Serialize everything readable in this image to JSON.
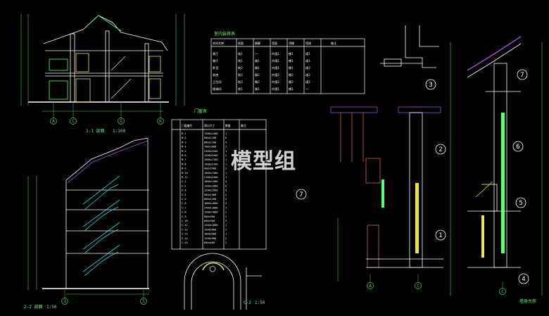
{
  "watermark": "模型组",
  "colors": {
    "background": "#000000",
    "line": "#ffffff",
    "dim": "#4fd06a",
    "text_green": "#5bff7a",
    "teal": "#2fd5d5",
    "yellow": "#e6e64a",
    "roof": "#9a4fd0",
    "wood": "#c07050"
  },
  "views": {
    "section_1": {
      "title": "1-1 剖面",
      "scale": "1:100"
    },
    "section_2": {
      "title": "2-2 剖面",
      "scale": "1:50"
    },
    "section_c": {
      "title": "C-2",
      "scale": "1:50"
    },
    "door_window_table": {
      "title": "门窗表"
    },
    "room_table": {
      "title": "室内装修表"
    },
    "wall_section": {
      "title": "墙身大样"
    }
  },
  "axis_labels": {
    "section_1": [
      "A",
      "C",
      "G",
      "K"
    ],
    "section_2": [
      "1",
      "5"
    ],
    "detail_bottom": [
      "A",
      "C"
    ],
    "right_bottom": [
      "C"
    ]
  },
  "detail_markers": [
    "1",
    "2",
    "3",
    "4",
    "5",
    "6",
    "7",
    "7"
  ],
  "room_table": {
    "headers": [
      "房间名称",
      "地面",
      "踢脚",
      "墙面",
      "顶棚",
      "墙裙",
      "备注"
    ],
    "rows": [
      [
        "客厅",
        "地1",
        "——",
        "内墙1",
        "棚1",
        "裙1",
        ""
      ],
      [
        "餐厅",
        "地1",
        "踢1",
        "内墙1",
        "棚1",
        "裙1",
        ""
      ],
      [
        "卧室",
        "地2",
        "踢1",
        "内墙1",
        "棚1",
        "裙2",
        ""
      ],
      [
        "厨房",
        "地3",
        "踢2",
        "内墙2",
        "棚2",
        "裙2",
        ""
      ],
      [
        "卫生间",
        "地3",
        "踢2",
        "内墙2",
        "棚2",
        "裙2",
        ""
      ],
      [
        "楼梯间",
        "地1",
        "踢1",
        "内墙1",
        "棚1",
        "——",
        ""
      ]
    ]
  },
  "door_table": {
    "headers": [
      "门窗编号",
      "洞口尺寸",
      "数量",
      "备注"
    ],
    "rows": [
      [
        "M-1",
        "1500x2400",
        "1",
        ""
      ],
      [
        "M-2",
        "900x2100",
        "6",
        ""
      ],
      [
        "M-3",
        "800x2100",
        "4",
        ""
      ],
      [
        "M-4",
        "700x2000",
        "2",
        ""
      ],
      [
        "M-5",
        "2400x2400",
        "1",
        ""
      ],
      [
        "M-6",
        "1200x2400",
        "2",
        ""
      ],
      [
        "M-7",
        "1000x2100",
        "1",
        ""
      ],
      [
        "M-8",
        "1500x2100",
        "1",
        ""
      ],
      [
        "M-9",
        "900x2400",
        "2",
        ""
      ],
      [
        "M-10",
        "1800x2400",
        "1",
        ""
      ],
      [
        "M-11",
        "2100x2400",
        "1",
        ""
      ],
      [
        "C-1",
        "1800x1500",
        "4",
        ""
      ],
      [
        "C-2",
        "1500x1500",
        "6",
        ""
      ],
      [
        "C-3",
        "1200x1500",
        "3",
        ""
      ],
      [
        "C-4",
        "900x1500",
        "2",
        ""
      ],
      [
        "C-5",
        "600x1200",
        "4",
        ""
      ],
      [
        "C-6",
        "1800x1800",
        "2",
        ""
      ],
      [
        "C-7",
        "2400x1800",
        "1",
        ""
      ],
      [
        "C-8",
        "1500x1800",
        "2",
        ""
      ],
      [
        "C-9",
        "900x900",
        "2",
        ""
      ],
      [
        "C-10",
        "600x900",
        "3",
        ""
      ],
      [
        "C-11",
        "1200x1800",
        "1",
        ""
      ],
      [
        "C-12",
        "1500x900",
        "2",
        ""
      ],
      [
        "C-13",
        "1800x900",
        "1",
        ""
      ],
      [
        "C-14",
        "1200x900",
        "2",
        ""
      ],
      [
        "C-15",
        "600x600",
        "2",
        ""
      ]
    ]
  }
}
